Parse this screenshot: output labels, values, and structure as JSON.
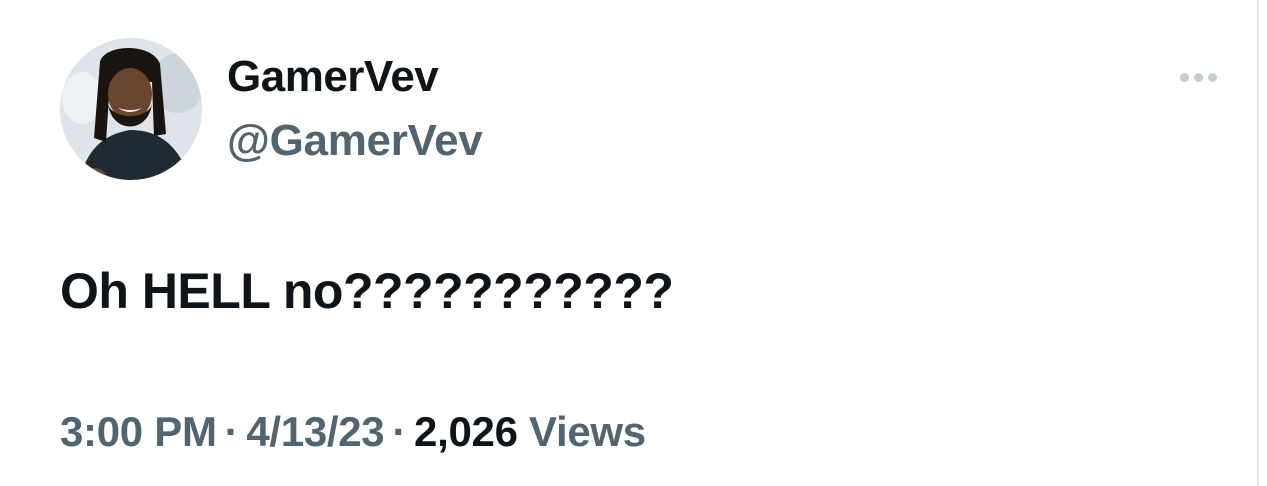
{
  "author": {
    "display_name": "GamerVev",
    "handle": "@GamerVev",
    "avatar_icon": "profile-photo"
  },
  "more_icon": "ellipsis-icon",
  "tweet": {
    "text": "Oh HELL no???????????"
  },
  "meta": {
    "time": "3:00 PM",
    "separator": "·",
    "date": "4/13/23",
    "view_count": "2,026",
    "views_label": "Views"
  },
  "colors": {
    "primary_text": "#0f1419",
    "secondary_text": "#536471",
    "muted_icon": "#c4ccd3",
    "background": "#ffffff"
  }
}
